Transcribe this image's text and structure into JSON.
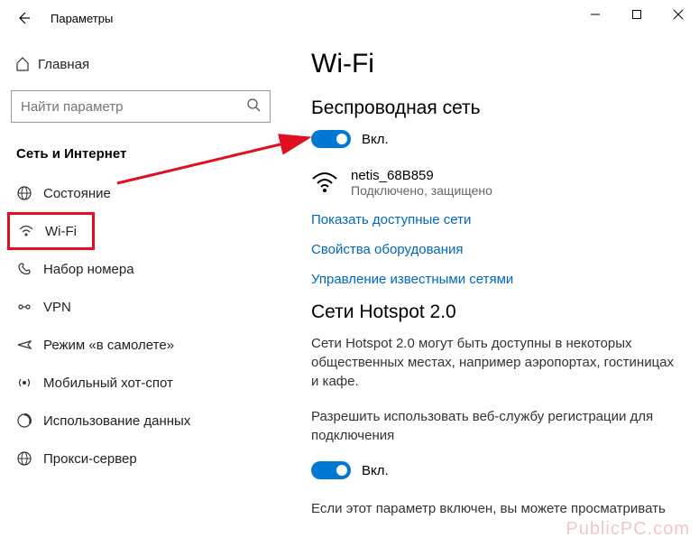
{
  "window": {
    "title": "Параметры"
  },
  "sidebar": {
    "home_label": "Главная",
    "search_placeholder": "Найти параметр",
    "section_title": "Сеть и Интернет",
    "items": [
      {
        "label": "Состояние",
        "icon": "globe-icon"
      },
      {
        "label": "Wi-Fi",
        "icon": "wifi-icon"
      },
      {
        "label": "Набор номера",
        "icon": "dialup-icon"
      },
      {
        "label": "VPN",
        "icon": "vpn-icon"
      },
      {
        "label": "Режим «в самолете»",
        "icon": "airplane-icon"
      },
      {
        "label": "Мобильный хот-спот",
        "icon": "hotspot-icon"
      },
      {
        "label": "Использование данных",
        "icon": "data-usage-icon"
      },
      {
        "label": "Прокси-сервер",
        "icon": "proxy-icon"
      }
    ]
  },
  "content": {
    "heading": "Wi-Fi",
    "wireless": {
      "title": "Беспроводная сеть",
      "toggle_on": true,
      "toggle_label": "Вкл."
    },
    "network": {
      "name": "netis_68B859",
      "status": "Подключено, защищено"
    },
    "links": {
      "show_networks": "Показать доступные сети",
      "hardware_props": "Свойства оборудования",
      "manage_known": "Управление известными сетями"
    },
    "hotspot20": {
      "title": "Сети Hotspot 2.0",
      "desc": "Сети Hotspot 2.0 могут быть доступны в некоторых общественных местах, например аэропортах, гостиницах и кафе.",
      "permit_label": "Разрешить использовать веб-службу регистрации для подключения",
      "toggle_on": true,
      "toggle_label": "Вкл.",
      "footer": "Если этот параметр включен, вы можете просматривать"
    }
  },
  "watermark": "PublicPC.com"
}
